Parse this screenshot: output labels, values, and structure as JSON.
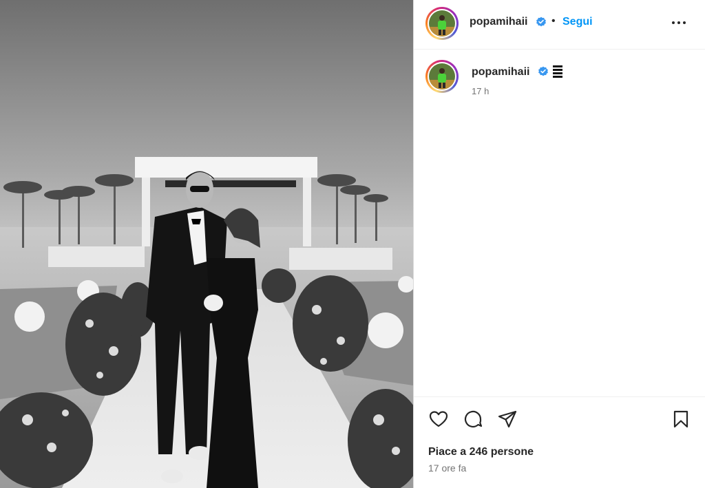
{
  "header": {
    "username": "popamihaii",
    "separator": "•",
    "follow_label": "Segui",
    "more_icon": "more-horizontal-icon"
  },
  "caption": {
    "username": "popamihaii",
    "emoji": "flag-emoji",
    "time": "17 h"
  },
  "actions": {
    "like_icon": "heart-icon",
    "comment_icon": "comment-icon",
    "share_icon": "send-icon",
    "save_icon": "bookmark-icon"
  },
  "likes_text": "Piace a 246 persone",
  "post_time": "17 ore fa",
  "colors": {
    "accent": "#0095f6",
    "verified": "#3897f0",
    "text": "#262626",
    "muted": "#737373",
    "border": "#dbdbdb"
  }
}
